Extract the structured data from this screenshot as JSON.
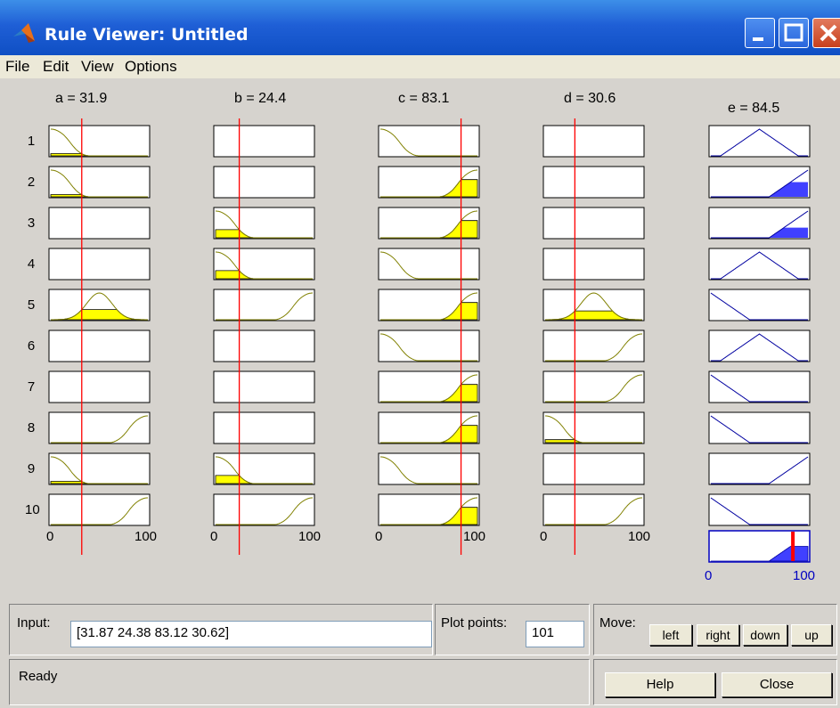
{
  "window": {
    "title": "Rule Viewer: Untitled"
  },
  "menu": [
    "File",
    "Edit",
    "View",
    "Options"
  ],
  "inputs": [
    {
      "label": "a = 31.9",
      "range": [
        0,
        100
      ],
      "value": 31.9,
      "mf": [
        [
          "zmf",
          0,
          40
        ],
        [
          "zmf",
          0,
          40
        ],
        null,
        null,
        [
          "gauss",
          50,
          13
        ],
        null,
        null,
        [
          "smf",
          60,
          100
        ],
        [
          "zmf",
          0,
          40
        ],
        [
          "smf",
          60,
          100
        ]
      ]
    },
    {
      "label": "b = 24.4",
      "range": [
        0,
        100
      ],
      "value": 24.4,
      "mf": [
        null,
        null,
        [
          "zmf",
          0,
          40
        ],
        [
          "zmf",
          0,
          40
        ],
        [
          "smf",
          60,
          100
        ],
        null,
        null,
        null,
        [
          "zmf",
          0,
          40
        ],
        [
          "smf",
          60,
          100
        ]
      ]
    },
    {
      "label": "c = 83.1",
      "range": [
        0,
        100
      ],
      "value": 83.1,
      "mf": [
        [
          "zmf",
          0,
          40
        ],
        [
          "smf",
          60,
          100
        ],
        [
          "smf",
          60,
          100
        ],
        [
          "zmf",
          0,
          40
        ],
        [
          "smf",
          60,
          100
        ],
        [
          "zmf",
          0,
          40
        ],
        [
          "smf",
          60,
          100
        ],
        [
          "smf",
          60,
          100
        ],
        [
          "zmf",
          0,
          40
        ],
        [
          "smf",
          60,
          100
        ]
      ]
    },
    {
      "label": "d = 30.6",
      "range": [
        0,
        100
      ],
      "value": 30.6,
      "mf": [
        null,
        null,
        null,
        null,
        [
          "gauss",
          50,
          13
        ],
        [
          "smf",
          60,
          100
        ],
        [
          "smf",
          60,
          100
        ],
        [
          "zmf",
          0,
          40
        ],
        null,
        [
          "smf",
          60,
          100
        ]
      ]
    }
  ],
  "output": {
    "label": "e = 84.5",
    "range": [
      0,
      100
    ],
    "value": 84.5,
    "mf": [
      "trimf",
      "rise",
      "rise",
      "trimf",
      "fall",
      "trimf",
      "fall",
      "fall",
      "rise",
      "fall"
    ],
    "rule_firing": [
      0.0,
      0.55,
      0.38,
      0.0,
      0.0,
      0.0,
      0.0,
      0.0,
      0.0,
      0.0
    ]
  },
  "rules": [
    "1",
    "2",
    "3",
    "4",
    "5",
    "6",
    "7",
    "8",
    "9",
    "10"
  ],
  "axis_ticks": [
    "0",
    "100"
  ],
  "bottom": {
    "input_label": "Input:",
    "input_value": "[31.87 24.38 83.12 30.62]",
    "plotpoints_label": "Plot points:",
    "plotpoints_value": "101",
    "move_label": "Move:",
    "move_buttons": [
      "left",
      "right",
      "down",
      "up"
    ],
    "status": "Ready",
    "help_label": "Help",
    "close_label": "Close"
  },
  "colors": {
    "fill_input": "#ffff00",
    "fill_output": "#4040ff",
    "curve_input": "#808000",
    "curve_output": "#0000a0",
    "indicator": "#ff0000"
  }
}
